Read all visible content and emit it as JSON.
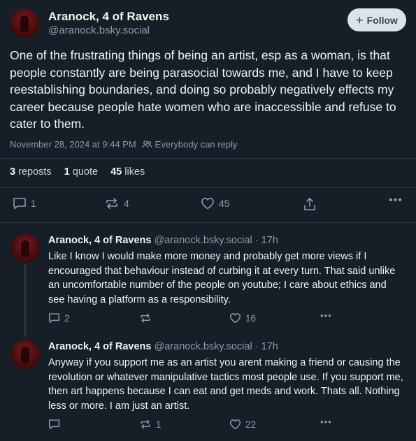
{
  "main_post": {
    "author_name": "Aranock, 4 of Ravens",
    "author_handle": "@aranock.bsky.social",
    "follow_label": "Follow",
    "text": "One of the frustrating things of being an artist, esp as a woman, is that people constantly are being parasocial towards me, and I have to keep reestablishing boundaries, and doing so probably negatively effects my career because people hate women who are inaccessible and refuse to cater to them.",
    "timestamp": "November 28, 2024 at 9:44 PM",
    "reply_setting": "Everybody can reply",
    "stats": {
      "reposts_count": "3",
      "reposts_label": "reposts",
      "quotes_count": "1",
      "quotes_label": "quote",
      "likes_count": "45",
      "likes_label": "likes"
    },
    "actions": {
      "replies": "1",
      "reposts": "4",
      "likes": "45"
    }
  },
  "replies": [
    {
      "author_name": "Aranock, 4 of Ravens",
      "author_handle": "@aranock.bsky.social",
      "time": "· 17h",
      "text": "Like I know I would make more money and probably get more views if I encouraged that behaviour instead of curbing it at every turn. That said unlike an uncomfortable number of the people on youtube; I care about ethics and see having a platform as a responsibility.",
      "replies": "2",
      "reposts": "",
      "likes": "16"
    },
    {
      "author_name": "Aranock, 4 of Ravens",
      "author_handle": "@aranock.bsky.social",
      "time": "· 17h",
      "text": "Anyway if you support me as an artist you arent making a friend or causing the revolution or whatever manipulative tactics most people use. If you support me, then art happens because I can eat and get meds and work. Thats all. Nothing less or more. I am just an artist.",
      "replies": "",
      "reposts": "1",
      "likes": "22"
    }
  ],
  "icons": {
    "reply": "reply-bubble-icon",
    "repost": "repost-arrows-icon",
    "like": "heart-icon",
    "share": "share-upload-icon",
    "more": "more-dots-icon",
    "audience": "people-icon"
  },
  "colors": {
    "background": "#161e27",
    "text": "#f1f3f5",
    "muted": "#8c9bb0",
    "follow_button_bg": "#dde3ea",
    "divider": "#2c3846"
  }
}
